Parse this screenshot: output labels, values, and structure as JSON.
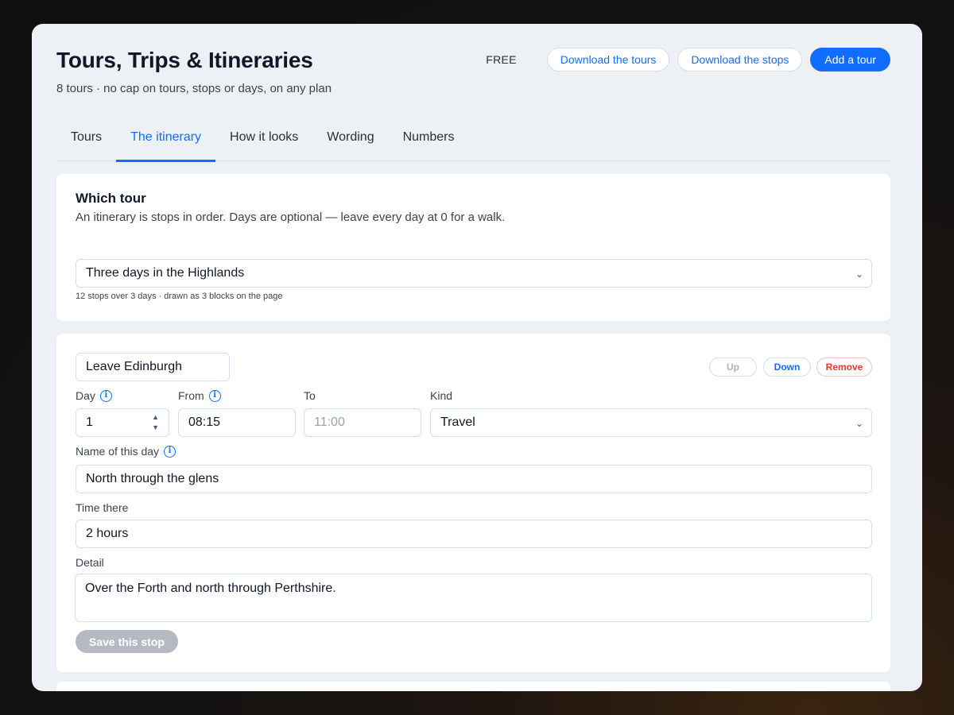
{
  "header": {
    "title": "Tours, Trips & Itineraries",
    "subtitle": "8 tours · no cap on tours, stops or days, on any plan",
    "plan": "FREE",
    "download_tours": "Download the tours",
    "download_stops": "Download the stops",
    "add_tour": "Add a tour"
  },
  "tabs": [
    "Tours",
    "The itinerary",
    "How it looks",
    "Wording",
    "Numbers"
  ],
  "active_tab": "The itinerary",
  "which_tour": {
    "title": "Which tour",
    "description": "An itinerary is stops in order. Days are optional — leave every day at 0 for a walk.",
    "selected": "Three days in the Highlands",
    "hint": "12 stops over 3 days · drawn as 3 blocks on the page"
  },
  "stop": {
    "name": "Leave Edinburgh",
    "up_label": "Up",
    "down_label": "Down",
    "remove_label": "Remove",
    "day_label": "Day",
    "day_value": "1",
    "from_label": "From",
    "from_value": "08:15",
    "to_label": "To",
    "to_placeholder": "11:00",
    "kind_label": "Kind",
    "kind_value": "Travel",
    "day_name_label": "Name of this day",
    "day_name_value": "North through the glens",
    "time_there_label": "Time there",
    "time_there_value": "2 hours",
    "detail_label": "Detail",
    "detail_value": "Over the Forth and north through Perthshire.",
    "save_label": "Save this stop"
  },
  "colors": {
    "accent": "#116dff",
    "danger": "#e03a2f",
    "disabled": "#b5bac2"
  },
  "icons": {
    "info": "info-icon",
    "chevron": "chevron-down-icon",
    "stepper": "stepper-icon"
  }
}
